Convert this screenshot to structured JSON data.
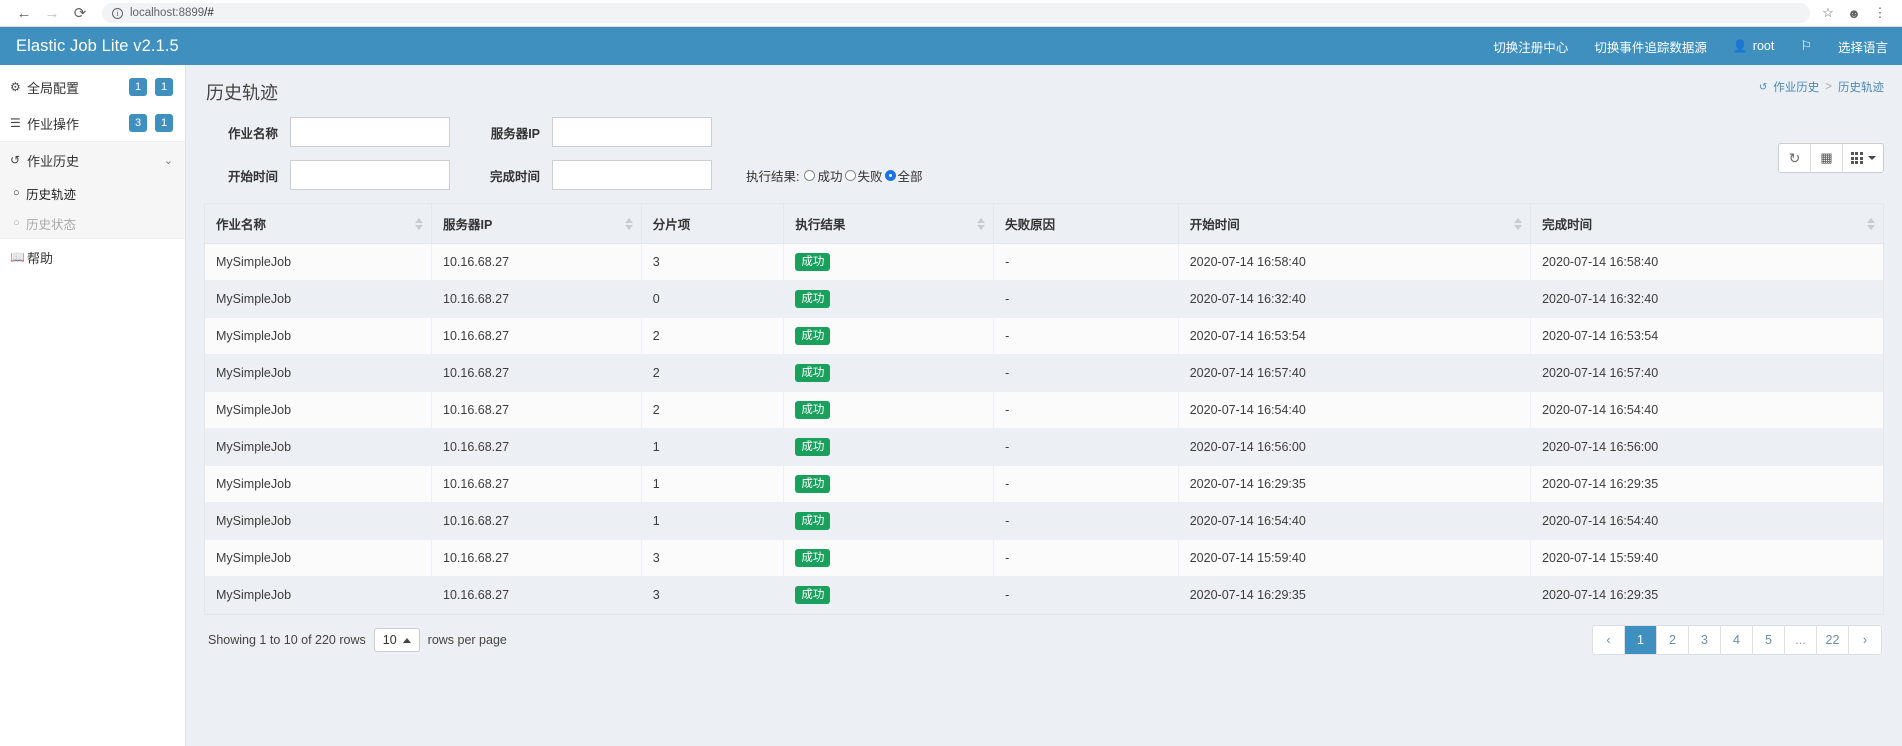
{
  "browser": {
    "back_icon": "back-arrow",
    "forward_icon": "forward-arrow",
    "reload_icon": "reload",
    "info_icon": "i",
    "url_host": "localhost:8899",
    "url_path": "/#",
    "star_icon": "☆",
    "profile_icon": "account",
    "menu_icon": "⋮"
  },
  "navbar": {
    "brand": "Elastic Job Lite v2.1.5",
    "items": [
      {
        "label": "切换注册中心"
      },
      {
        "label": "切换事件追踪数据源"
      }
    ],
    "user": "root",
    "flag_icon": "flag",
    "language_label": "选择语言"
  },
  "sidebar": {
    "items": [
      {
        "label": "全局配置",
        "icon": "gears-icon",
        "badges": [
          "1",
          "1"
        ]
      },
      {
        "label": "作业操作",
        "icon": "list-icon",
        "badges": [
          "3",
          "1"
        ]
      }
    ],
    "group": {
      "label": "作业历史",
      "icon": "history-icon",
      "chevron": "⌄",
      "children": [
        {
          "label": "历史轨迹",
          "active": true
        },
        {
          "label": "历史状态",
          "active": false
        }
      ]
    },
    "help": {
      "label": "帮助",
      "icon": "book-icon"
    }
  },
  "page": {
    "title": "历史轨迹",
    "breadcrumb": {
      "parent": "作业历史",
      "separator": ">",
      "current": "历史轨迹"
    }
  },
  "filters": {
    "job_name": {
      "label": "作业名称",
      "value": "",
      "placeholder": ""
    },
    "server_ip": {
      "label": "服务器IP",
      "value": "",
      "placeholder": ""
    },
    "start_time": {
      "label": "开始时间",
      "value": "",
      "placeholder": ""
    },
    "complete_time": {
      "label": "完成时间",
      "value": "",
      "placeholder": ""
    },
    "result": {
      "label": "执行结果:",
      "options": [
        {
          "label": "成功",
          "checked": false
        },
        {
          "label": "失败",
          "checked": false
        },
        {
          "label": "全部",
          "checked": true
        }
      ]
    }
  },
  "toolbar": {
    "refresh_icon": "refresh-icon",
    "toggle_icon": "list-view-icon",
    "columns_icon": "columns-grid-icon"
  },
  "table": {
    "columns": [
      {
        "label": "作业名称",
        "sortable": true
      },
      {
        "label": "服务器IP",
        "sortable": true
      },
      {
        "label": "分片项",
        "sortable": false
      },
      {
        "label": "执行结果",
        "sortable": true
      },
      {
        "label": "失败原因",
        "sortable": false
      },
      {
        "label": "开始时间",
        "sortable": true
      },
      {
        "label": "完成时间",
        "sortable": true
      }
    ],
    "rows": [
      {
        "job": "MySimpleJob",
        "ip": "10.16.68.27",
        "shard": "3",
        "result": "成功",
        "reason": "-",
        "start": "2020-07-14 16:58:40",
        "end": "2020-07-14 16:58:40"
      },
      {
        "job": "MySimpleJob",
        "ip": "10.16.68.27",
        "shard": "0",
        "result": "成功",
        "reason": "-",
        "start": "2020-07-14 16:32:40",
        "end": "2020-07-14 16:32:40"
      },
      {
        "job": "MySimpleJob",
        "ip": "10.16.68.27",
        "shard": "2",
        "result": "成功",
        "reason": "-",
        "start": "2020-07-14 16:53:54",
        "end": "2020-07-14 16:53:54"
      },
      {
        "job": "MySimpleJob",
        "ip": "10.16.68.27",
        "shard": "2",
        "result": "成功",
        "reason": "-",
        "start": "2020-07-14 16:57:40",
        "end": "2020-07-14 16:57:40"
      },
      {
        "job": "MySimpleJob",
        "ip": "10.16.68.27",
        "shard": "2",
        "result": "成功",
        "reason": "-",
        "start": "2020-07-14 16:54:40",
        "end": "2020-07-14 16:54:40"
      },
      {
        "job": "MySimpleJob",
        "ip": "10.16.68.27",
        "shard": "1",
        "result": "成功",
        "reason": "-",
        "start": "2020-07-14 16:56:00",
        "end": "2020-07-14 16:56:00"
      },
      {
        "job": "MySimpleJob",
        "ip": "10.16.68.27",
        "shard": "1",
        "result": "成功",
        "reason": "-",
        "start": "2020-07-14 16:29:35",
        "end": "2020-07-14 16:29:35"
      },
      {
        "job": "MySimpleJob",
        "ip": "10.16.68.27",
        "shard": "1",
        "result": "成功",
        "reason": "-",
        "start": "2020-07-14 16:54:40",
        "end": "2020-07-14 16:54:40"
      },
      {
        "job": "MySimpleJob",
        "ip": "10.16.68.27",
        "shard": "3",
        "result": "成功",
        "reason": "-",
        "start": "2020-07-14 15:59:40",
        "end": "2020-07-14 15:59:40"
      },
      {
        "job": "MySimpleJob",
        "ip": "10.16.68.27",
        "shard": "3",
        "result": "成功",
        "reason": "-",
        "start": "2020-07-14 16:29:35",
        "end": "2020-07-14 16:29:35"
      }
    ]
  },
  "footer": {
    "showing_text": "Showing 1 to 10 of 220 rows",
    "page_size": "10",
    "rows_per_page_text": "rows per page",
    "pagination": {
      "prev": "‹",
      "pages": [
        "1",
        "2",
        "3",
        "4",
        "5",
        "...",
        "22"
      ],
      "next": "›",
      "active": "1"
    }
  },
  "colors": {
    "brand_blue": "#3f8fbf",
    "success_green": "#18a05c",
    "content_bg": "#eceff3",
    "radio_blue": "#1a73e8"
  }
}
